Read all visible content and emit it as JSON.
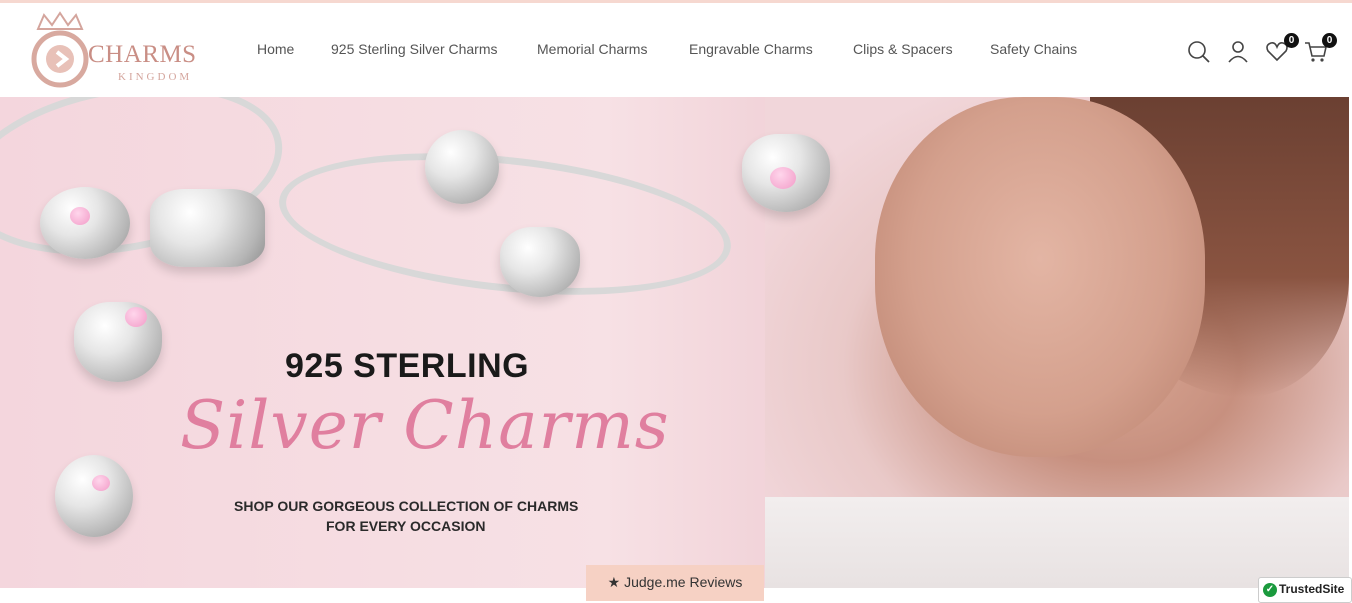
{
  "brand": {
    "name": "CHARMS",
    "tagline": "KINGDOM",
    "accent": "#c98e85"
  },
  "nav": {
    "items": [
      {
        "label": "Home"
      },
      {
        "label": "925 Sterling Silver Charms"
      },
      {
        "label": "Memorial Charms"
      },
      {
        "label": "Engravable Charms"
      },
      {
        "label": "Clips & Spacers"
      },
      {
        "label": "Safety Chains"
      }
    ]
  },
  "header_icons": {
    "search": "search-icon",
    "account": "user-icon",
    "wishlist": {
      "icon": "heart-icon",
      "count": "0"
    },
    "cart": {
      "icon": "cart-icon",
      "count": "0"
    }
  },
  "hero": {
    "title_line1": "925 STERLING",
    "title_line2": "Silver Charms",
    "subtitle_line1": "SHOP OUR GORGEOUS COLLECTION OF CHARMS",
    "subtitle_line2": "FOR EVERY OCCASION",
    "title_color": "#e07f9f"
  },
  "reviews_tab": {
    "label": "★ Judge.me Reviews",
    "bg": "#f6d1c4"
  },
  "trusted_badge": {
    "label": "TrustedSite"
  }
}
